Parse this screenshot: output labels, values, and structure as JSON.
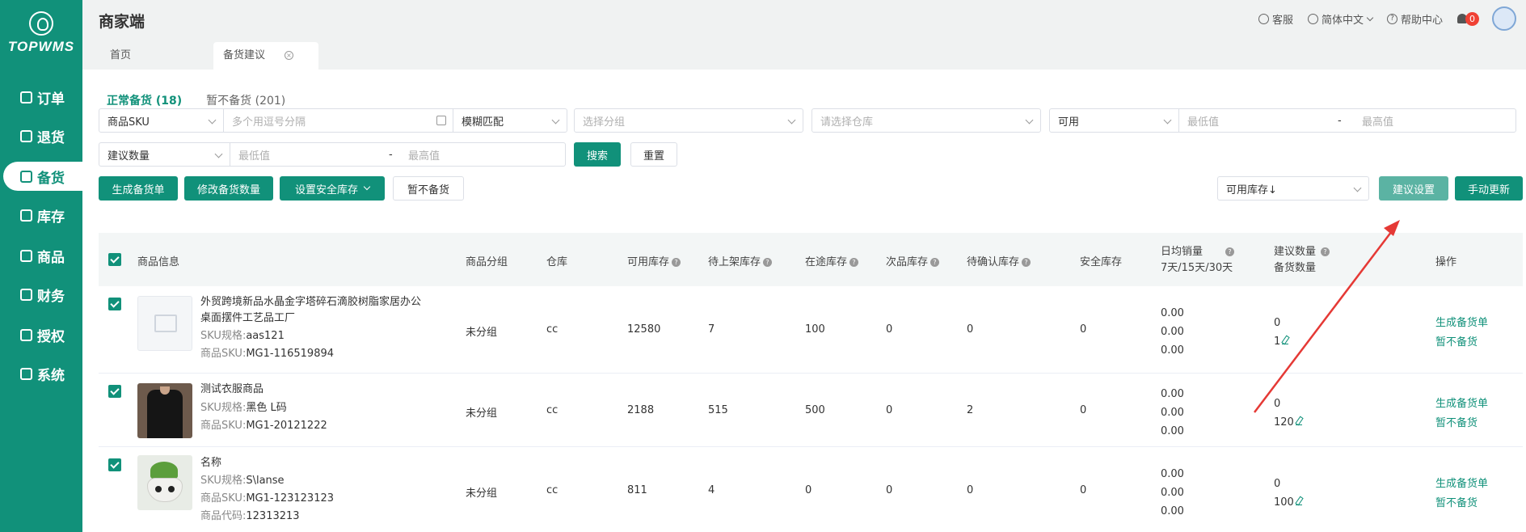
{
  "sidebar": {
    "logo_text": "TOPWMS",
    "items": [
      {
        "label": "订单",
        "icon": "list-icon"
      },
      {
        "label": "退货",
        "icon": "return-icon"
      },
      {
        "label": "备货",
        "icon": "stock-icon",
        "active": true
      },
      {
        "label": "库存",
        "icon": "inventory-icon"
      },
      {
        "label": "商品",
        "icon": "goods-icon"
      },
      {
        "label": "财务",
        "icon": "finance-icon"
      },
      {
        "label": "授权",
        "icon": "auth-icon"
      },
      {
        "label": "系统",
        "icon": "settings-icon"
      }
    ]
  },
  "topbar": {
    "title": "商家端",
    "service": "客服",
    "language": "简体中文",
    "help": "帮助中心",
    "notifications": "0"
  },
  "page_tabs": [
    {
      "label": "首页"
    },
    {
      "label": "备货建议",
      "active": true
    }
  ],
  "subtabs": [
    {
      "label": "正常备货 (18)",
      "active": true
    },
    {
      "label": "暂不备货 (201)"
    }
  ],
  "filters": {
    "sku_type": "商品SKU",
    "sku_placeholder": "多个用逗号分隔",
    "match_mode": "模糊匹配",
    "group_placeholder": "选择分组",
    "warehouse_placeholder": "请选择仓库",
    "stock_type": "可用",
    "min_placeholder": "最低值",
    "max_placeholder": "最高值",
    "dash": "-",
    "suggest_type": "建议数量",
    "search": "搜索",
    "reset": "重置"
  },
  "actions": {
    "generate": "生成备货单",
    "modify_qty": "修改备货数量",
    "set_safety": "设置安全库存",
    "pause": "暂不备货",
    "sort": "可用库存↓",
    "suggest_settings": "建议设置",
    "manual_update": "手动更新"
  },
  "table": {
    "headers": {
      "product": "商品信息",
      "group": "商品分组",
      "warehouse": "仓库",
      "available": "可用库存",
      "pending_shelf": "待上架库存",
      "in_transit": "在途库存",
      "defective": "次品库存",
      "pending_confirm": "待确认库存",
      "safety": "安全库存",
      "daily_sales": "日均销量",
      "daily_sales_sub": "7天/15天/30天",
      "suggest": "建议数量",
      "suggest_sub": "备货数量",
      "ops": "操作"
    },
    "rows": [
      {
        "title_line1": "外贸跨境新品水晶金字塔碎石滴胶树脂家居办公",
        "title_line2": "桌面摆件工艺品工厂",
        "spec_label": "SKU规格:",
        "spec": "aas121",
        "sku_label": "商品SKU:",
        "sku": "MG1-116519894",
        "thumb": "placeholder-image-icon",
        "group": "未分组",
        "warehouse": "cc",
        "available": "12580",
        "pending_shelf": "7",
        "in_transit": "100",
        "defective": "0",
        "pending_confirm": "0",
        "safety": "0",
        "sales": [
          "0.00",
          "0.00",
          "0.00"
        ],
        "suggest": "0",
        "stock_qty": "1",
        "op1": "生成备货单",
        "op2": "暂不备货"
      },
      {
        "title_line1": "测试衣服商品",
        "spec_label": "SKU规格:",
        "spec": "黑色 L码",
        "sku_label": "商品SKU:",
        "sku": "MG1-20121222",
        "thumb": "shirt-photo",
        "group": "未分组",
        "warehouse": "cc",
        "available": "2188",
        "pending_shelf": "515",
        "in_transit": "500",
        "defective": "0",
        "pending_confirm": "2",
        "safety": "0",
        "sales": [
          "0.00",
          "0.00",
          "0.00"
        ],
        "suggest": "0",
        "stock_qty": "120",
        "op1": "生成备货单",
        "op2": "暂不备货"
      },
      {
        "title_line1": "名称",
        "spec_label": "SKU规格:",
        "spec": "S\\lanse",
        "sku_label": "商品SKU:",
        "sku": "MG1-123123123",
        "code_label": "商品代码:",
        "code": "12313213",
        "thumb": "plant-pot-photo",
        "group": "未分组",
        "warehouse": "cc",
        "available": "811",
        "pending_shelf": "4",
        "in_transit": "0",
        "defective": "0",
        "pending_confirm": "0",
        "safety": "0",
        "sales": [
          "0.00",
          "0.00",
          "0.00"
        ],
        "suggest": "0",
        "stock_qty": "100",
        "op1": "生成备货单",
        "op2": "暂不备货"
      }
    ]
  },
  "colors": {
    "primary": "#11917a",
    "annotation_arrow": "#e53935",
    "badge": "#f04134"
  }
}
